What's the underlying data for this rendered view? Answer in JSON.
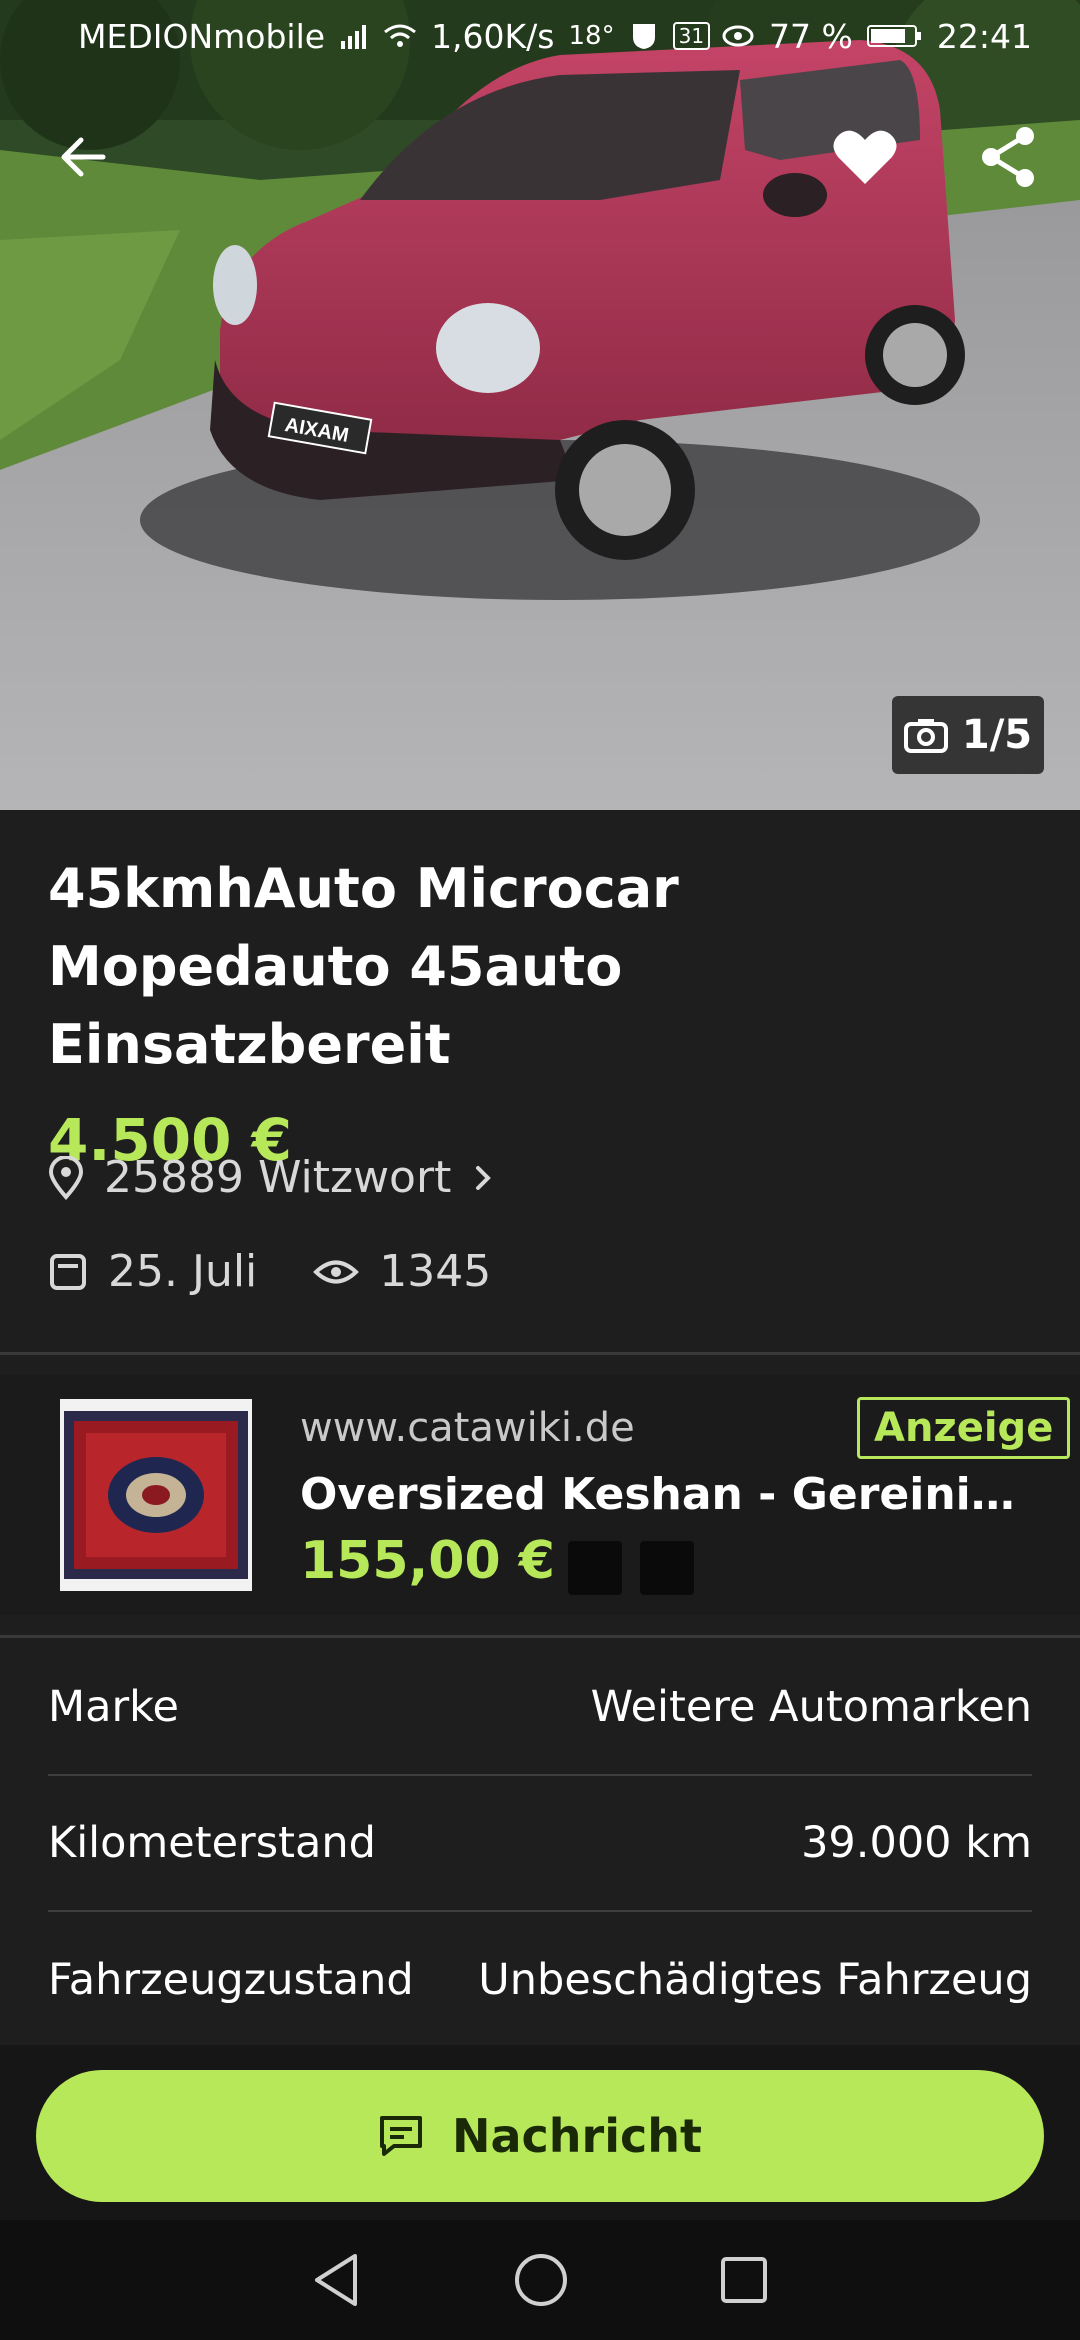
{
  "status_bar": {
    "carrier": "MEDIONmobile",
    "speed": "1,60K/s",
    "temperature": "18°",
    "calendar_day": "31",
    "battery": "77 %",
    "time": "22:41"
  },
  "hero": {
    "photo_counter": "1/5",
    "license_plate": "AIXAM"
  },
  "listing": {
    "title": "45kmhAuto Microcar Mopedauto 45auto Einsatzbereit",
    "price": "4.500 €",
    "location": "25889 Witzwort",
    "date": "25. Juli",
    "views": "1345"
  },
  "ad": {
    "url": "www.catawiki.de",
    "badge": "Anzeige",
    "title": "Oversized Keshan - Gereinigter...",
    "price": "155,00 €"
  },
  "attributes": [
    {
      "label": "Marke",
      "value": "Weitere Automarken"
    },
    {
      "label": "Kilometerstand",
      "value": "39.000 km"
    },
    {
      "label": "Fahrzeugzustand",
      "value": "Unbeschädigtes Fahrzeug"
    }
  ],
  "cta": {
    "label": "Nachricht"
  },
  "colors": {
    "accent": "#b7e85a",
    "background": "#1f1e1e"
  },
  "icons": [
    "back-arrow-icon",
    "heart-icon",
    "share-icon",
    "camera-icon",
    "location-pin-icon",
    "chevron-right-icon",
    "calendar-icon",
    "eye-icon",
    "chat-icon",
    "nav-back-icon",
    "nav-home-icon",
    "nav-recents-icon"
  ]
}
